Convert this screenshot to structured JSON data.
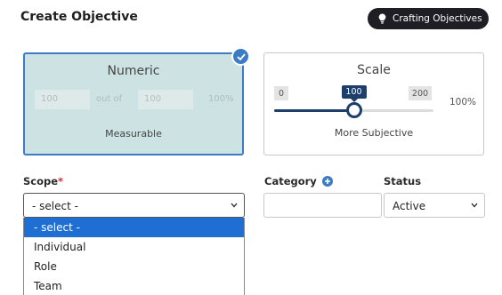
{
  "header": {
    "title": "Create Objective",
    "help_button": {
      "label": "Crafting Objectives",
      "icon": "lightbulb-icon"
    }
  },
  "types": {
    "numeric": {
      "title": "Numeric",
      "selected": true,
      "min_placeholder": "100",
      "out_of": "out of",
      "max_placeholder": "100",
      "percent": "100%",
      "subtitle": "Measurable"
    },
    "scale": {
      "title": "Scale",
      "min": "0",
      "max": "200",
      "value": "100",
      "value_fraction": 0.5,
      "percent": "100%",
      "subtitle": "More Subjective"
    }
  },
  "form": {
    "scope": {
      "label": "Scope",
      "required_mark": "*",
      "value": "- select -",
      "options": [
        "- select -",
        "Individual",
        "Role",
        "Team"
      ],
      "highlighted_index": 0
    },
    "category": {
      "label": "Category",
      "value": ""
    },
    "status": {
      "label": "Status",
      "value": "Active"
    }
  },
  "colors": {
    "accent": "#3d7bc5",
    "slider": "#1d3f6a",
    "selected_card_bg": "#cde3e3",
    "dropdown_highlight": "#1f6ed4",
    "required": "#d32f2f"
  }
}
